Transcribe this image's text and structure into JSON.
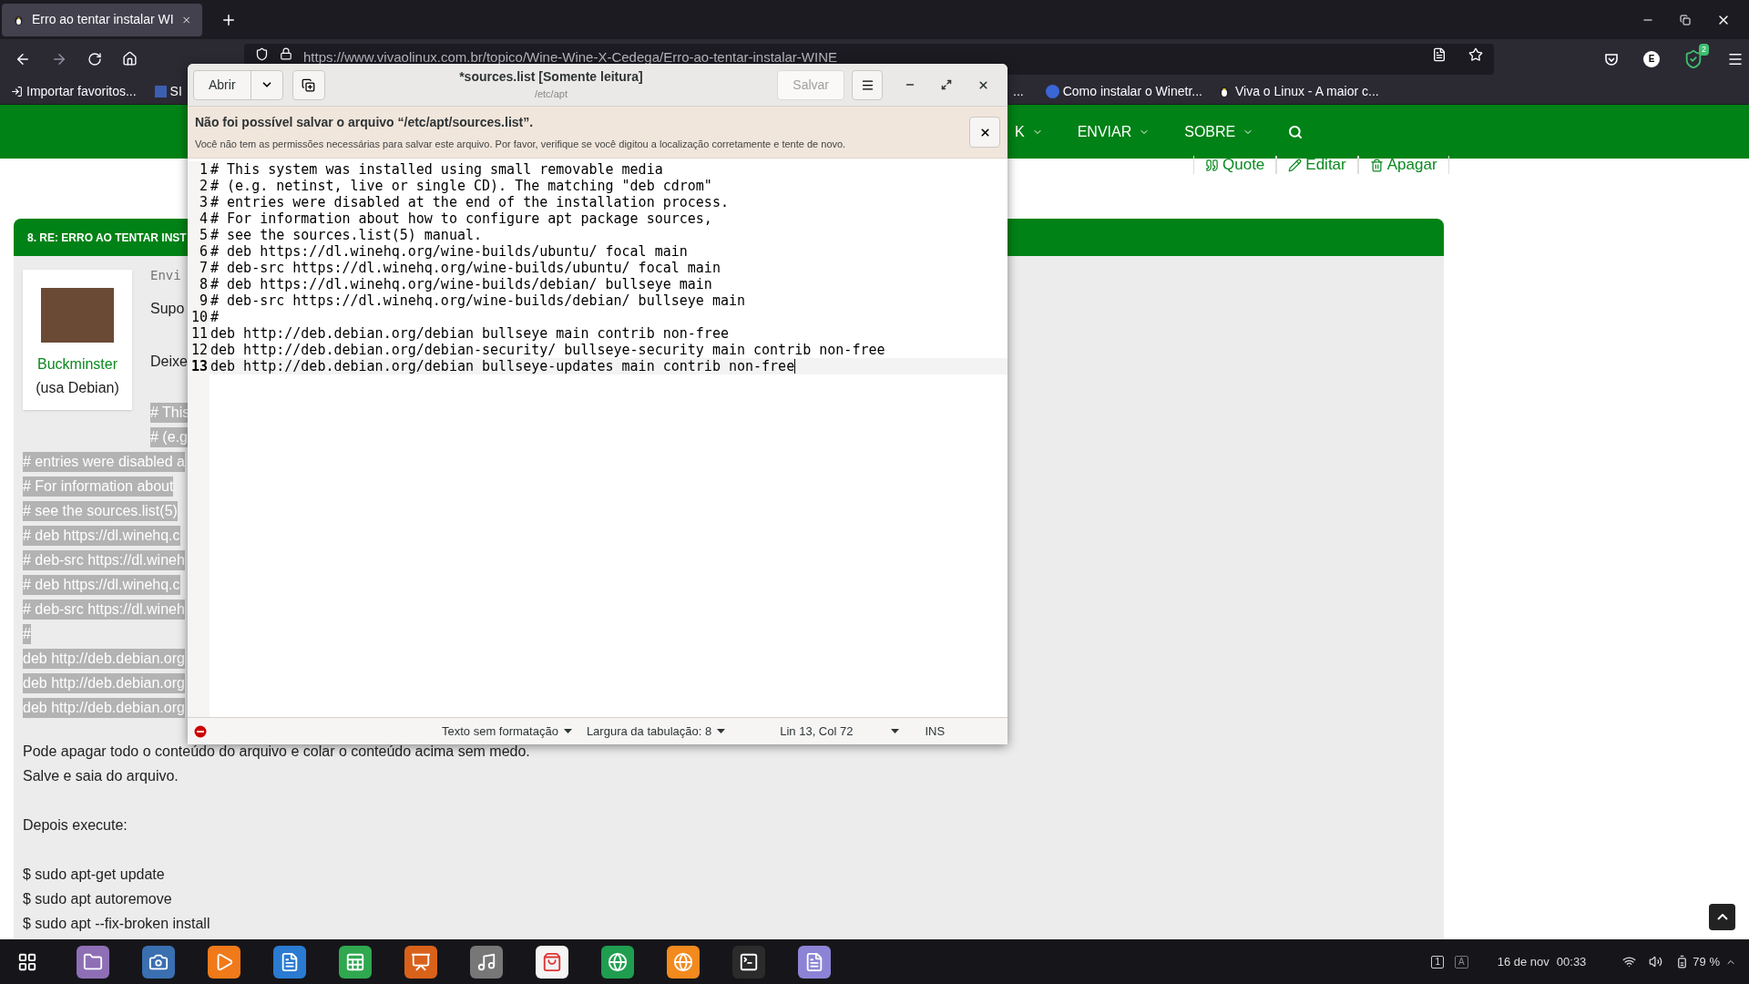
{
  "browser": {
    "tabs": [
      {
        "title": "Erro ao tentar instalar WI",
        "selected": true
      }
    ],
    "url": "https://www.vivaolinux.com.br/topico/Wine-Wine-X-Cedega/Erro-ao-tentar-instalar-WINE",
    "bookmarks_left": [
      "Importar favoritos...",
      "SI"
    ],
    "bookmarks_right": [
      "...",
      "Como instalar o Winetr...",
      "Viva o Linux - A maior c..."
    ],
    "profile_initial": "E",
    "extension_badge": "2"
  },
  "site": {
    "nav": [
      "K",
      "ENVIAR",
      "SOBRE"
    ],
    "post_actions": [
      "Quote",
      "Editar",
      "Apagar"
    ],
    "post": {
      "heading": "8. RE: ERRO AO TENTAR INST",
      "author": "Buckminster",
      "author_note": "(usa Debian)",
      "meta": "Envi",
      "intro": [
        "Supo",
        "Deixe"
      ],
      "code_indented": [
        "# This",
        "# (e.g"
      ],
      "code": [
        "# entries were disabled a",
        "# For information about",
        "# see the sources.list(5)",
        "# deb https://dl.winehq.c",
        "# deb-src https://dl.wineh",
        "# deb https://dl.winehq.c",
        "# deb-src https://dl.wineh",
        "#",
        "deb http://deb.debian.org",
        "deb http://deb.debian.org",
        "deb http://deb.debian.org"
      ],
      "after": [
        [
          "Pode apagar todo o conteúdo do arquivo e colar o conteúdo acima sem medo.",
          "Salve e saia do arquivo."
        ],
        [
          "Depois execute:"
        ],
        [
          "$ sudo apt-get update",
          "$ sudo apt autoremove",
          "$ sudo apt --fix-broken install"
        ]
      ]
    }
  },
  "editor": {
    "title": "*sources.list [Somente leitura]",
    "subtitle": "/etc/apt",
    "open_button": "Abrir",
    "save_button": {
      "label": "Salvar",
      "disabled": true
    },
    "infobar": {
      "title": "Não foi possível salvar o arquivo “/etc/apt/sources.list”.",
      "message": "Você não tem as permissões necessárias para salvar este arquivo. Por favor, verifique se você digitou a localização corretamente e tente de novo."
    },
    "lines": [
      {
        "number": "1",
        "text": "# This system was installed using small removable media",
        "current": false
      },
      {
        "number": "2",
        "text": "# (e.g. netinst, live or single CD). The matching \"deb cdrom\"",
        "current": false
      },
      {
        "number": "3",
        "text": "# entries were disabled at the end of the installation process.",
        "current": false
      },
      {
        "number": "4",
        "text": "# For information about how to configure apt package sources,",
        "current": false
      },
      {
        "number": "5",
        "text": "# see the sources.list(5) manual.",
        "current": false
      },
      {
        "number": "6",
        "text": "# deb https://dl.winehq.org/wine-builds/ubuntu/ focal main",
        "current": false
      },
      {
        "number": "7",
        "text": "# deb-src https://dl.winehq.org/wine-builds/ubuntu/ focal main",
        "current": false
      },
      {
        "number": "8",
        "text": "# deb https://dl.winehq.org/wine-builds/debian/ bullseye main",
        "current": false
      },
      {
        "number": "9",
        "text": "# deb-src https://dl.winehq.org/wine-builds/debian/ bullseye main",
        "current": false
      },
      {
        "number": "10",
        "text": "#",
        "current": false
      },
      {
        "number": "11",
        "text": "deb http://deb.debian.org/debian bullseye main contrib non-free",
        "current": false
      },
      {
        "number": "12",
        "text": "deb http://deb.debian.org/debian-security/ bullseye-security main contrib non-free",
        "current": false
      },
      {
        "number": "13",
        "text": "deb http://deb.debian.org/debian bullseye-updates main contrib non-free",
        "current": true
      }
    ],
    "status": {
      "syntax": "Texto sem formatação",
      "tab_width": "Largura da tabulação: 8",
      "position": "Lin 13, Col 72",
      "mode": "INS"
    }
  },
  "taskbar": {
    "workspace": "1",
    "input": "A",
    "date": "16 de nov",
    "time": "00:33",
    "battery": "79 %"
  }
}
